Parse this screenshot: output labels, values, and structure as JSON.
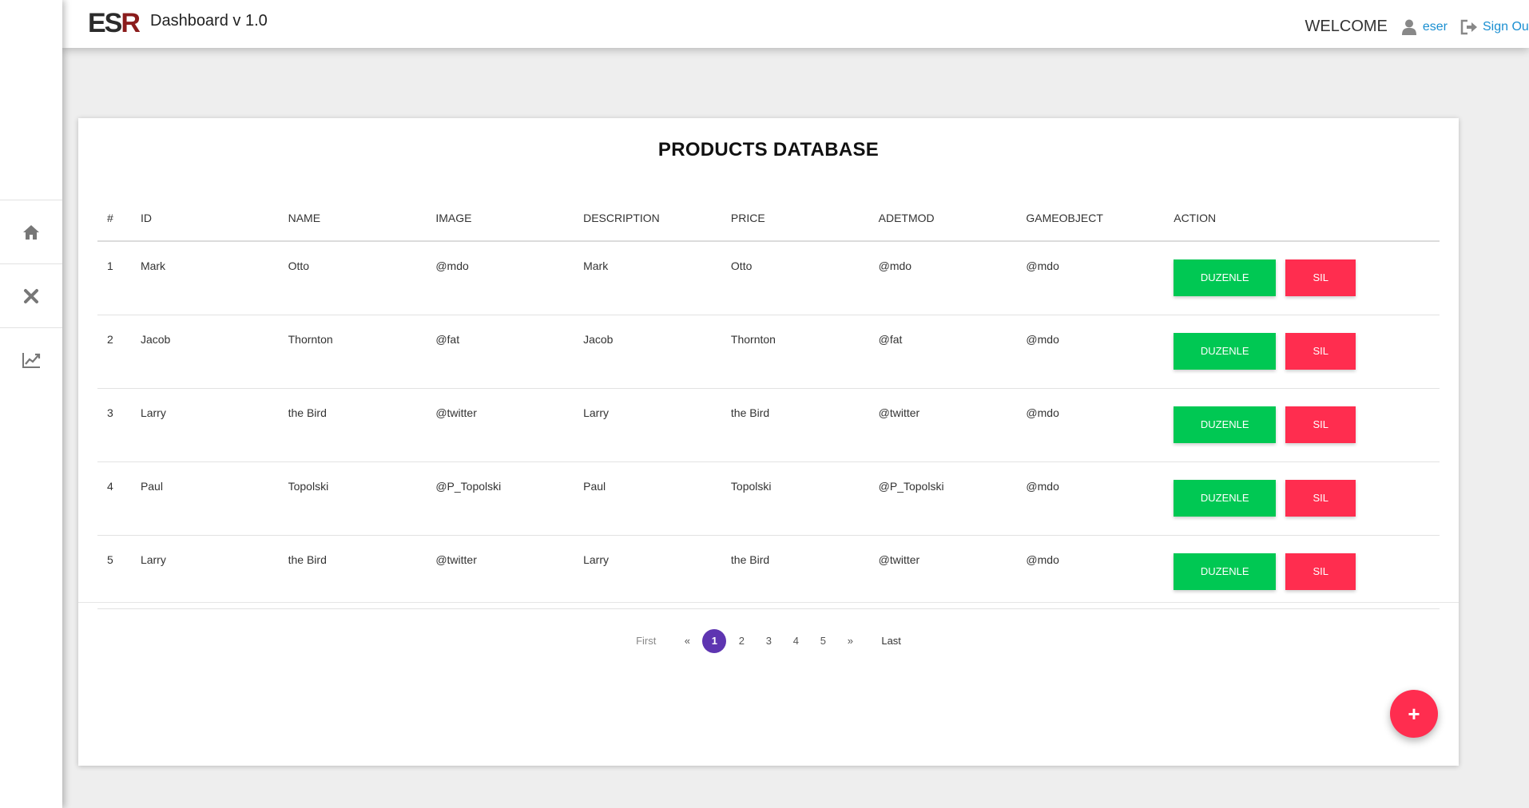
{
  "app": {
    "logo_text_main": "ES",
    "logo_text_accent": "R",
    "title": "Dashboard v 1.0"
  },
  "header": {
    "welcome": "WELCOME",
    "username": "eser",
    "signout_label": "Sign Out"
  },
  "sidebar": {
    "items": [
      {
        "icon": "home-icon"
      },
      {
        "icon": "close-icon"
      },
      {
        "icon": "chart-line-icon"
      }
    ]
  },
  "table": {
    "title": "PRODUCTS DATABASE",
    "columns": [
      "#",
      "ID",
      "NAME",
      "IMAGE",
      "DESCRIPTION",
      "PRICE",
      "ADETMOD",
      "GAMEOBJECT",
      "ACTION"
    ],
    "rows": [
      {
        "num": "1",
        "id": "Mark",
        "name": "Otto",
        "image": "@mdo",
        "description": "Mark",
        "price": "Otto",
        "adetmod": "@mdo",
        "gameobject": "@mdo"
      },
      {
        "num": "2",
        "id": "Jacob",
        "name": "Thornton",
        "image": "@fat",
        "description": "Jacob",
        "price": "Thornton",
        "adetmod": "@fat",
        "gameobject": "@mdo"
      },
      {
        "num": "3",
        "id": "Larry",
        "name": "the Bird",
        "image": "@twitter",
        "description": "Larry",
        "price": "the Bird",
        "adetmod": "@twitter",
        "gameobject": "@mdo"
      },
      {
        "num": "4",
        "id": "Paul",
        "name": "Topolski",
        "image": "@P_Topolski",
        "description": "Paul",
        "price": "Topolski",
        "adetmod": "@P_Topolski",
        "gameobject": "@mdo"
      },
      {
        "num": "5",
        "id": "Larry",
        "name": "the Bird",
        "image": "@twitter",
        "description": "Larry",
        "price": "the Bird",
        "adetmod": "@twitter",
        "gameobject": "@mdo"
      }
    ],
    "edit_label": "DUZENLE",
    "delete_label": "SIL"
  },
  "pagination": {
    "first": "First",
    "prev": "«",
    "pages": [
      "1",
      "2",
      "3",
      "4",
      "5"
    ],
    "current": "1",
    "next": "»",
    "last": "Last"
  },
  "fab": {
    "label": "+"
  },
  "colors": {
    "edit": "#00c853",
    "delete": "#ff2d4f",
    "active_page": "#5e35b1",
    "link": "#1a8fd1"
  }
}
